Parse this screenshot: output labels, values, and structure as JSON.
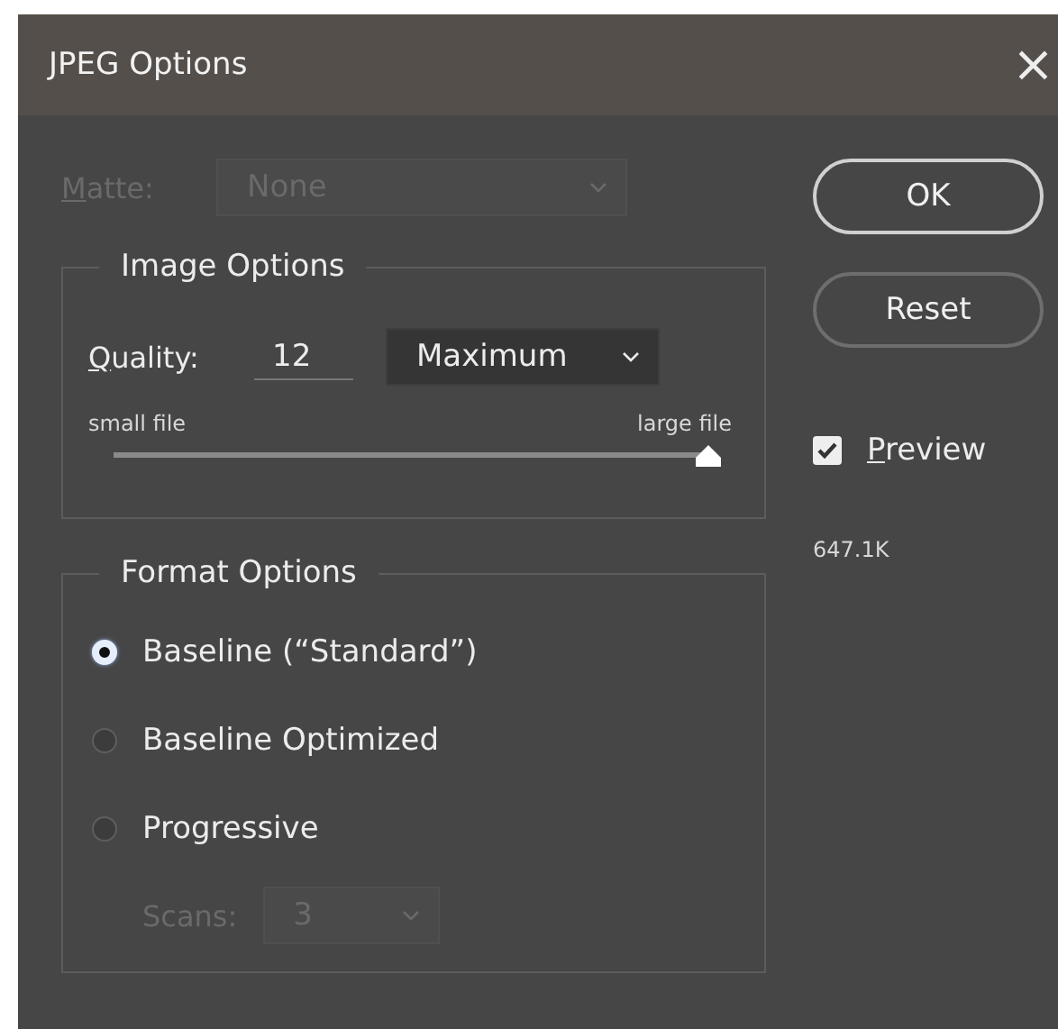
{
  "window": {
    "title": "JPEG Options",
    "close": "×"
  },
  "matte": {
    "label": "Matte:",
    "value": "None",
    "disabled": true
  },
  "image_options": {
    "title": "Image Options",
    "quality_label": "Quality:",
    "quality_value": "12",
    "quality_preset": "Maximum",
    "min_label": "small file",
    "max_label": "large file",
    "level": 1
  },
  "format_options": {
    "title": "Format Options",
    "options": [
      {
        "label": "Baseline (“Standard”)",
        "selected": true
      },
      {
        "label": "Baseline Optimized",
        "selected": false
      },
      {
        "label": "Progressive",
        "selected": false
      }
    ],
    "scans": {
      "label": "Scans:",
      "value": "3",
      "disabled": true
    }
  },
  "buttons": [
    {
      "label": "OK",
      "default": true
    },
    {
      "label": "Reset",
      "default": false
    }
  ],
  "preview": {
    "label": "Preview",
    "checked": true
  },
  "file_size": "647.1K"
}
